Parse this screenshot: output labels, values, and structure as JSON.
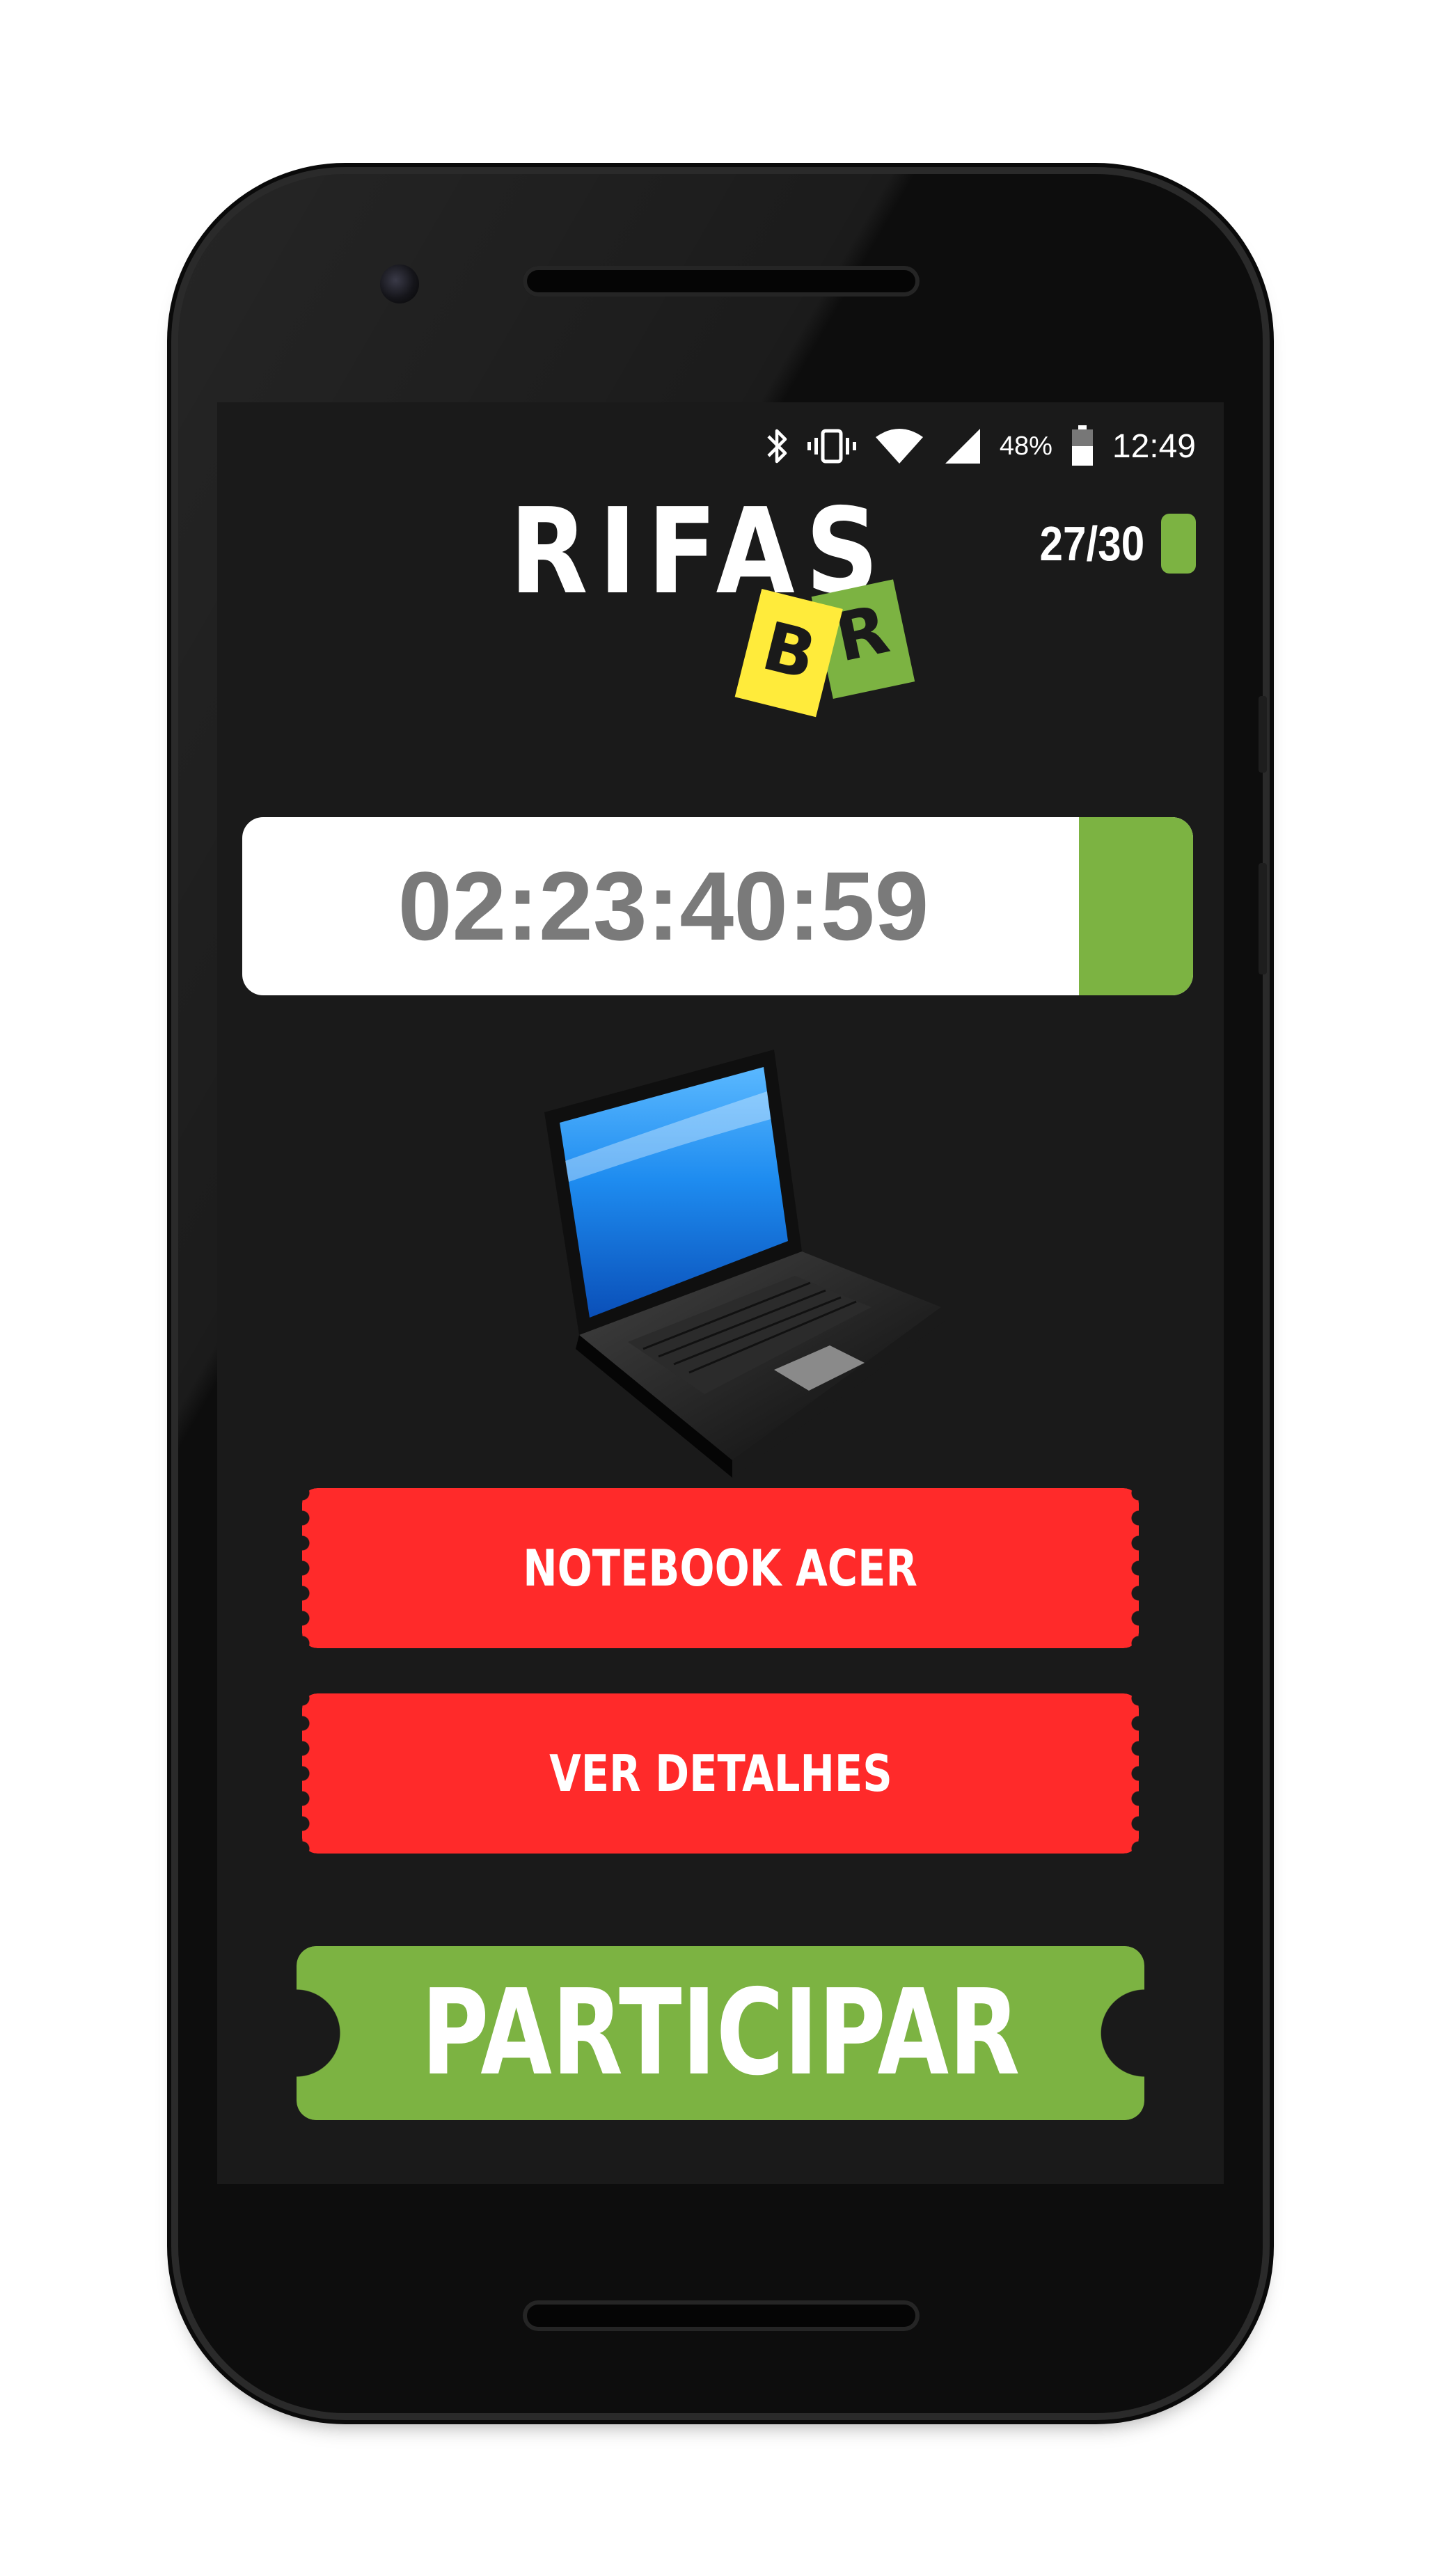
{
  "status_bar": {
    "icons": [
      "bluetooth-icon",
      "vibrate-icon",
      "wifi-icon",
      "signal-icon",
      "battery-icon"
    ],
    "battery_percent": "48%",
    "time": "12:49"
  },
  "logo": {
    "word": "RIFAS",
    "ticket_letters": [
      "B",
      "R"
    ],
    "colors": {
      "yellow": "#ffeb3b",
      "green": "#7cb342"
    }
  },
  "counter": {
    "text": "27/30",
    "icon": "battery-indicator-icon"
  },
  "timer": {
    "value": "02:23:40:59",
    "progress_fill_fraction": 0.12,
    "fill_color": "#7cb342"
  },
  "prize": {
    "image": "laptop-icon"
  },
  "buttons": {
    "product_name": "NOTEBOOK ACER",
    "details": "VER DETALHES",
    "participate": "PARTICIPAR"
  },
  "colors": {
    "background": "#1a1a1a",
    "red_ticket": "#ff2a2a",
    "green": "#7cb342",
    "timer_text": "#7a7a7a"
  }
}
